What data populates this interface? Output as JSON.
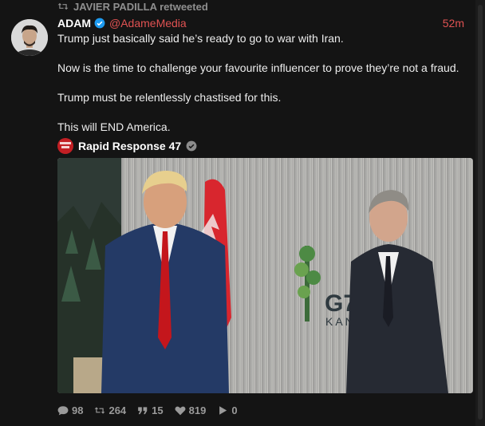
{
  "retweet": {
    "by": "JAVIER PADILLA retweeted"
  },
  "tweet": {
    "display_name": "ADAM",
    "handle": "@AdameMedia",
    "time": "52m",
    "paragraphs": [
      "Trump just basically said he’s ready to go to war with Iran.",
      "Now is the time to challenge your favourite influencer to prove they’re not a fraud.",
      "Trump must be relentlessly chastised for this.",
      "This will END America."
    ]
  },
  "quoted": {
    "account": "Rapid Response 47"
  },
  "media": {
    "logo_text_1": "G7",
    "logo_text_2": "KAN"
  },
  "stats": {
    "replies": "98",
    "retweets": "264",
    "quotes": "15",
    "likes": "819",
    "views": "0"
  },
  "colors": {
    "accent": "#e05252",
    "verified_blue": "#1d9bf0",
    "background": "#141414"
  }
}
